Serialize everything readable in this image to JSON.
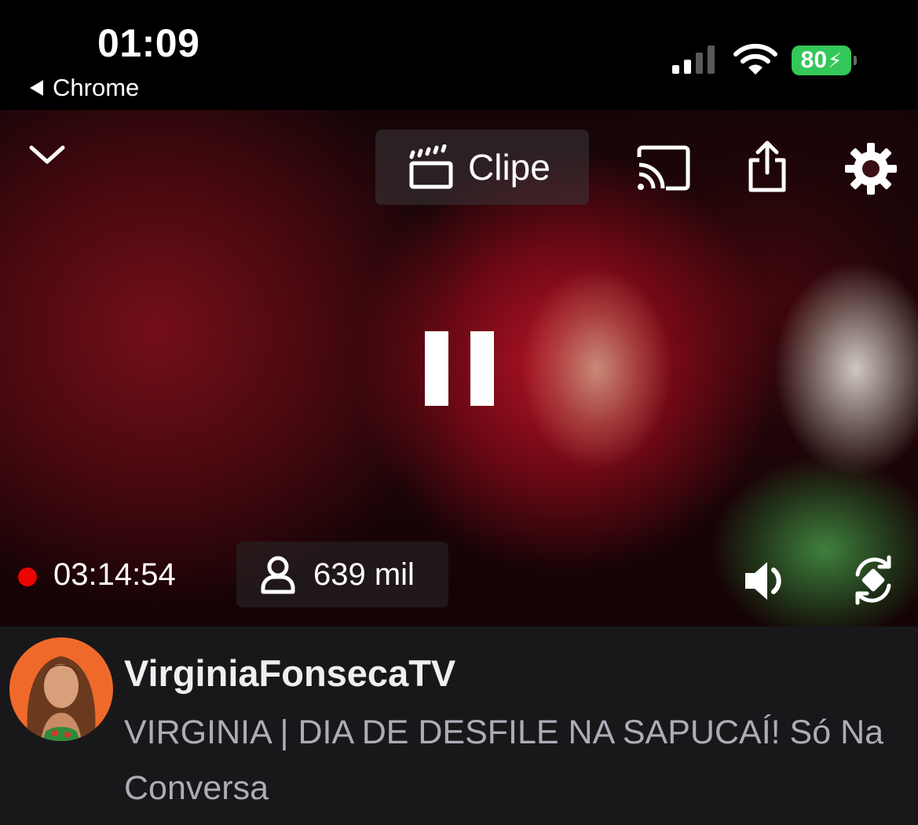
{
  "status_bar": {
    "time": "01:09",
    "back_app_label": "Chrome",
    "battery_level": "80",
    "battery_charging": true,
    "signal_bars_active": 2,
    "signal_bars_total": 4
  },
  "player": {
    "clip_label": "Clipe",
    "live_indicator_color": "#eb0400",
    "uptime": "03:14:54",
    "viewers": "639 mil",
    "state": "playing"
  },
  "stream_info": {
    "channel_name": "VirginiaFonsecaTV",
    "title": "VIRGINIA | DIA DE DESFILE NA SAPUCAÍ! Só Na Conversa"
  },
  "colors": {
    "battery_green": "#34c759",
    "info_background": "#18181b",
    "avatar_background": "#ef6a2a",
    "title_gray": "#adadb8"
  }
}
